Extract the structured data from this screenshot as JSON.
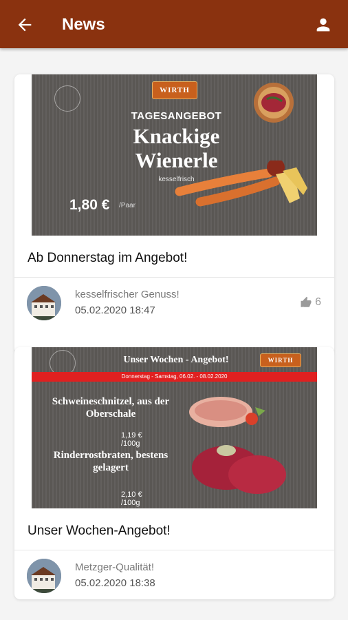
{
  "header": {
    "title": "News"
  },
  "posts": [
    {
      "banner": {
        "logo": "WIRTH",
        "subtitle": "TAGESANGEBOT",
        "product": "Knackige Wienerle",
        "note": "kesselfrisch",
        "price": "1,80 €",
        "unit": "/Paar"
      },
      "headline": "Ab Donnerstag im Angebot!",
      "caption": "kesselfrischer Genuss!",
      "date": "05.02.2020 18:47",
      "likes": "6"
    },
    {
      "banner": {
        "logo": "WIRTH",
        "title": "Unser Wochen - Angebot!",
        "period": "Donnerstag - Samstag, 06.02. - 08.02.2020",
        "item1": "Schweineschnitzel, aus der Oberschale",
        "price1": "1,19 € /100g",
        "item2": "Rinderrostbraten, bestens gelagert",
        "price2": "2,10 € /100g"
      },
      "headline": "Unser Wochen-Angebot!",
      "caption": "Metzger-Qualität!",
      "date": "05.02.2020 18:38"
    }
  ],
  "colors": {
    "appbar": "#8a320f",
    "accent_red": "#e02020"
  }
}
